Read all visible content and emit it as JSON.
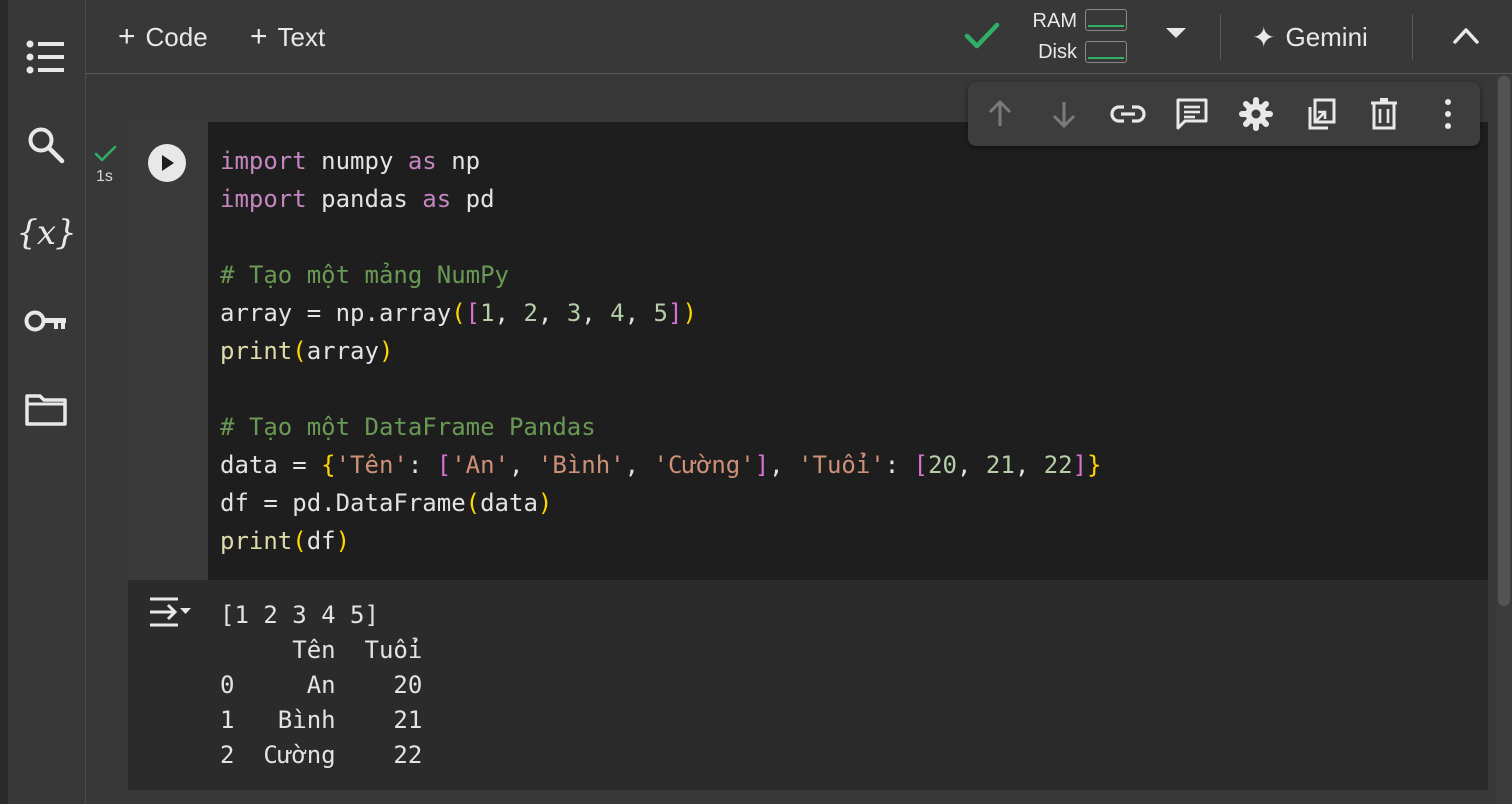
{
  "toolbar": {
    "add_code_label": "Code",
    "add_text_label": "Text",
    "ram_label": "RAM",
    "disk_label": "Disk",
    "gemini_label": "Gemini",
    "status_color": "#2fb066"
  },
  "sidebar": {
    "items": [
      {
        "name": "table-of-contents",
        "icon": "list-icon"
      },
      {
        "name": "search",
        "icon": "search-icon"
      },
      {
        "name": "variables",
        "icon": "variables-icon",
        "glyph": "{x}"
      },
      {
        "name": "secrets",
        "icon": "key-icon"
      },
      {
        "name": "files",
        "icon": "folder-icon"
      }
    ]
  },
  "cell": {
    "exec_time": "1s",
    "code_lines": [
      "import numpy as np",
      "import pandas as pd",
      "",
      "# Tạo một mảng NumPy",
      "array = np.array([1, 2, 3, 4, 5])",
      "print(array)",
      "",
      "# Tạo một DataFrame Pandas",
      "data = {'Tên': ['An', 'Bình', 'Cường'], 'Tuổi': [20, 21, 22]}",
      "df = pd.DataFrame(data)",
      "print(df)"
    ],
    "toolbar_icons": [
      "arrow-up-icon",
      "arrow-down-icon",
      "link-icon",
      "comment-icon",
      "gear-icon",
      "mirror-cell-icon",
      "trash-icon",
      "more-vert-icon"
    ]
  },
  "output": {
    "lines": [
      "[1 2 3 4 5]",
      "     Tên  Tuổi",
      "0     An    20",
      "1   Bình    21",
      "2  Cường    22"
    ]
  }
}
